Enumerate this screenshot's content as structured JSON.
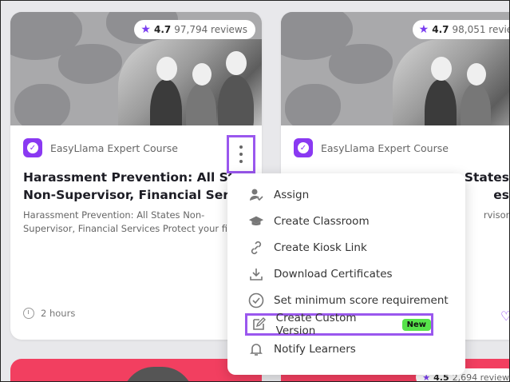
{
  "cards": [
    {
      "rating": {
        "score": "4.7",
        "count": "97,794 reviews"
      },
      "provider": "EasyLlama Expert Course",
      "title_line1": "Harassment Prevention: All States",
      "title_line2": "Non-Supervisor, Financial Services",
      "description": "Harassment Prevention: All States Non-Supervisor, Financial Services Protect your fi...",
      "duration": "2 hours"
    },
    {
      "rating": {
        "score": "4.7",
        "count": "98,051 review"
      },
      "provider": "EasyLlama Expert Course",
      "title_line1": "States",
      "title_line2": "es",
      "description": "rvisor,"
    }
  ],
  "bottom_rating": {
    "score": "4.5",
    "count": "2,694 review"
  },
  "menu": {
    "items": [
      {
        "label": "Assign",
        "icon": "assign-user-icon"
      },
      {
        "label": "Create Classroom",
        "icon": "graduation-cap-icon"
      },
      {
        "label": "Create Kiosk Link",
        "icon": "link-icon"
      },
      {
        "label": "Download Certificates",
        "icon": "download-icon"
      },
      {
        "label": "Set minimum score requirement",
        "icon": "check-circle-icon"
      },
      {
        "label": "Create Custom Version",
        "icon": "edit-icon",
        "badge": "New"
      },
      {
        "label": "Notify Learners",
        "icon": "bell-icon"
      }
    ]
  },
  "colors": {
    "accent": "#9a57ee",
    "brand": "#8a39f2",
    "new_badge": "#56e34a"
  }
}
